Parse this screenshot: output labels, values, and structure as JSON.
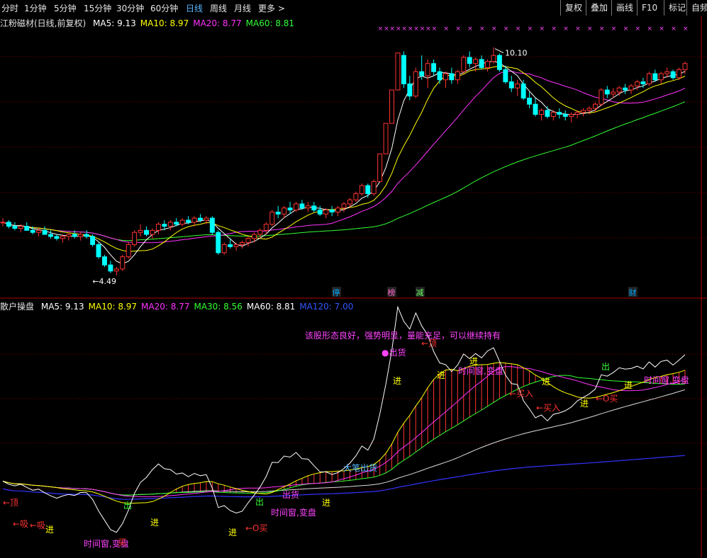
{
  "toolbar": {
    "periods": [
      "分时",
      "1分钟",
      "5分钟",
      "15分钟",
      "30分钟",
      "60分钟",
      "日线",
      "周线",
      "月线",
      "更多 >"
    ],
    "active_period": "日线",
    "right_buttons": [
      "复权",
      "叠加",
      "画线",
      "F10",
      "标记",
      "自频"
    ]
  },
  "price_panel": {
    "title": "江粉磁材(日线,前复权)",
    "ma": [
      {
        "label": "MA5: 9.13",
        "color": "#ffffff"
      },
      {
        "label": "MA10: 8.97",
        "color": "#ffff00"
      },
      {
        "label": "MA20: 8.77",
        "color": "#ff33ff"
      },
      {
        "label": "MA60: 8.81",
        "color": "#33ff33"
      }
    ],
    "high_label": "10.10",
    "low_label": "4.49",
    "badges": [
      {
        "text": "停",
        "color": "#00aaff"
      },
      {
        "text": "榜",
        "color": "#ff66cc"
      },
      {
        "text": "减",
        "color": "#66ff66"
      },
      {
        "text": "财",
        "color": "#00aaff"
      }
    ],
    "x_marker": "×"
  },
  "indicator_panel": {
    "title": "散户操盘",
    "ma": [
      {
        "label": "MA5: 9.13",
        "color": "#ffffff"
      },
      {
        "label": "MA10: 8.97",
        "color": "#ffff00"
      },
      {
        "label": "MA20: 8.77",
        "color": "#ff33ff"
      },
      {
        "label": "MA30: 8.56",
        "color": "#33ff33"
      },
      {
        "label": "MA60: 8.81",
        "color": "#ffffff"
      },
      {
        "label": "MA120: 7.00",
        "color": "#3355ff"
      }
    ],
    "comment": "该股形态良好，强势明显，量能充足，可以继续持有",
    "annotations": [
      {
        "text": "←顶",
        "color": "#ff3333"
      },
      {
        "text": "←吸",
        "color": "#ff3333"
      },
      {
        "text": "←吸",
        "color": "#ff3333"
      },
      {
        "text": "进",
        "color": "#ffff00"
      },
      {
        "text": "出",
        "color": "#33ff33"
      },
      {
        "text": "时间窗,变盘",
        "color": "#ff44ff"
      },
      {
        "text": "买",
        "color": "#ff3333"
      },
      {
        "text": "进",
        "color": "#ffff00"
      },
      {
        "text": "进",
        "color": "#ffff00"
      },
      {
        "text": "←O买",
        "color": "#ff3333"
      },
      {
        "text": "出",
        "color": "#33ff33"
      },
      {
        "text": "出货",
        "color": "#ff44ff"
      },
      {
        "text": "时间窗,变盘",
        "color": "#ff44ff"
      },
      {
        "text": "进",
        "color": "#ffff00"
      },
      {
        "text": "大笔出货",
        "color": "#55bbff"
      },
      {
        "text": "●出货",
        "color": "#ff44ff"
      },
      {
        "text": "进",
        "color": "#ffff00"
      },
      {
        "text": "←顶",
        "color": "#ff3333"
      },
      {
        "text": "进",
        "color": "#ffff00"
      },
      {
        "text": "进",
        "color": "#ffff00"
      },
      {
        "text": "时间窗,变盘",
        "color": "#ff44ff"
      },
      {
        "text": "←买入",
        "color": "#ff3333"
      },
      {
        "text": "进",
        "color": "#ffff00"
      },
      {
        "text": "←买入",
        "color": "#ff3333"
      },
      {
        "text": "进",
        "color": "#ffff00"
      },
      {
        "text": "←O买",
        "color": "#ff3333"
      },
      {
        "text": "出",
        "color": "#33ff33"
      },
      {
        "text": "进",
        "color": "#ffff00"
      },
      {
        "text": "时间窗,变盘",
        "color": "#ff44ff"
      }
    ]
  },
  "chart_data": {
    "type": "candlestick",
    "up_color": "#ff3333",
    "down_color": "#00ffff",
    "ohlc": [
      [
        5.8,
        5.9,
        5.7,
        5.8
      ],
      [
        5.8,
        5.85,
        5.65,
        5.7
      ],
      [
        5.7,
        5.8,
        5.6,
        5.65
      ],
      [
        5.65,
        5.75,
        5.55,
        5.7
      ],
      [
        5.7,
        5.8,
        5.6,
        5.6
      ],
      [
        5.6,
        5.7,
        5.5,
        5.55
      ],
      [
        5.55,
        5.65,
        5.45,
        5.6
      ],
      [
        5.6,
        5.7,
        5.5,
        5.5
      ],
      [
        5.5,
        5.6,
        5.4,
        5.45
      ],
      [
        5.45,
        5.5,
        5.35,
        5.4
      ],
      [
        5.4,
        5.5,
        5.3,
        5.45
      ],
      [
        5.45,
        5.55,
        5.35,
        5.5
      ],
      [
        5.5,
        5.6,
        5.4,
        5.45
      ],
      [
        5.45,
        5.55,
        5.35,
        5.5
      ],
      [
        5.5,
        5.6,
        5.4,
        5.45
      ],
      [
        5.45,
        5.5,
        5.2,
        5.25
      ],
      [
        5.25,
        5.3,
        4.9,
        4.95
      ],
      [
        4.95,
        5.0,
        4.7,
        4.75
      ],
      [
        4.75,
        4.85,
        4.55,
        4.6
      ],
      [
        4.6,
        4.7,
        4.49,
        4.65
      ],
      [
        4.65,
        5.0,
        4.6,
        4.95
      ],
      [
        4.95,
        5.3,
        4.9,
        5.25
      ],
      [
        5.25,
        5.6,
        5.2,
        5.55
      ],
      [
        5.55,
        5.75,
        5.45,
        5.6
      ],
      [
        5.6,
        5.7,
        5.45,
        5.5
      ],
      [
        5.5,
        5.65,
        5.4,
        5.6
      ],
      [
        5.6,
        5.8,
        5.5,
        5.75
      ],
      [
        5.75,
        5.85,
        5.6,
        5.7
      ],
      [
        5.7,
        5.85,
        5.6,
        5.8
      ],
      [
        5.8,
        5.9,
        5.7,
        5.75
      ],
      [
        5.75,
        5.9,
        5.7,
        5.85
      ],
      [
        5.85,
        5.95,
        5.75,
        5.8
      ],
      [
        5.8,
        5.95,
        5.7,
        5.9
      ],
      [
        5.9,
        6.0,
        5.8,
        5.85
      ],
      [
        5.85,
        5.95,
        5.75,
        5.9
      ],
      [
        5.9,
        5.95,
        5.5,
        5.55
      ],
      [
        5.55,
        5.6,
        5.0,
        5.05
      ],
      [
        5.05,
        5.3,
        5.0,
        5.25
      ],
      [
        5.25,
        5.4,
        5.15,
        5.2
      ],
      [
        5.2,
        5.3,
        5.1,
        5.25
      ],
      [
        5.25,
        5.35,
        5.15,
        5.3
      ],
      [
        5.3,
        5.45,
        5.2,
        5.4
      ],
      [
        5.4,
        5.55,
        5.3,
        5.5
      ],
      [
        5.5,
        5.65,
        5.4,
        5.6
      ],
      [
        5.6,
        5.8,
        5.5,
        5.75
      ],
      [
        5.75,
        6.1,
        5.7,
        6.05
      ],
      [
        6.05,
        6.2,
        5.9,
        6.0
      ],
      [
        6.0,
        6.2,
        5.9,
        6.15
      ],
      [
        6.15,
        6.3,
        6.0,
        6.1
      ],
      [
        6.1,
        6.3,
        6.05,
        6.25
      ],
      [
        6.25,
        6.35,
        6.1,
        6.15
      ],
      [
        6.15,
        6.3,
        6.05,
        6.2
      ],
      [
        6.2,
        6.3,
        6.05,
        6.1
      ],
      [
        6.1,
        6.2,
        5.95,
        6.0
      ],
      [
        6.0,
        6.15,
        5.9,
        6.1
      ],
      [
        6.1,
        6.2,
        5.95,
        6.05
      ],
      [
        6.05,
        6.2,
        5.95,
        6.15
      ],
      [
        6.15,
        6.3,
        6.05,
        6.25
      ],
      [
        6.25,
        6.4,
        6.15,
        6.35
      ],
      [
        6.35,
        6.55,
        6.3,
        6.5
      ],
      [
        6.5,
        6.75,
        6.45,
        6.7
      ],
      [
        6.7,
        6.75,
        6.4,
        6.5
      ],
      [
        6.5,
        6.85,
        6.45,
        6.8
      ],
      [
        6.8,
        7.48,
        6.8,
        7.48
      ],
      [
        7.48,
        8.23,
        7.48,
        8.23
      ],
      [
        8.23,
        9.05,
        8.23,
        9.05
      ],
      [
        9.05,
        9.96,
        9.05,
        9.96
      ],
      [
        9.9,
        10.0,
        9.1,
        9.2
      ],
      [
        9.2,
        9.4,
        8.8,
        8.9
      ],
      [
        8.9,
        9.6,
        8.85,
        9.5
      ],
      [
        9.5,
        9.9,
        9.3,
        9.4
      ],
      [
        9.4,
        9.8,
        9.1,
        9.7
      ],
      [
        9.7,
        9.8,
        9.4,
        9.5
      ],
      [
        9.5,
        9.6,
        9.2,
        9.3
      ],
      [
        9.3,
        9.5,
        9.1,
        9.45
      ],
      [
        9.45,
        9.6,
        9.2,
        9.3
      ],
      [
        9.3,
        9.55,
        9.2,
        9.5
      ],
      [
        9.5,
        9.9,
        9.45,
        9.85
      ],
      [
        9.85,
        10.0,
        9.6,
        9.7
      ],
      [
        9.7,
        9.85,
        9.5,
        9.8
      ],
      [
        9.8,
        9.9,
        9.55,
        9.6
      ],
      [
        9.6,
        9.8,
        9.5,
        9.75
      ],
      [
        9.75,
        10.1,
        9.7,
        9.9
      ],
      [
        9.9,
        9.95,
        9.5,
        9.55
      ],
      [
        9.55,
        9.65,
        9.2,
        9.25
      ],
      [
        9.25,
        9.4,
        9.0,
        9.1
      ],
      [
        9.1,
        9.3,
        8.9,
        9.2
      ],
      [
        9.2,
        9.3,
        8.8,
        8.85
      ],
      [
        8.85,
        9.0,
        8.6,
        8.7
      ],
      [
        8.7,
        8.85,
        8.4,
        8.45
      ],
      [
        8.45,
        8.6,
        8.3,
        8.55
      ],
      [
        8.55,
        8.65,
        8.35,
        8.4
      ],
      [
        8.4,
        8.55,
        8.3,
        8.5
      ],
      [
        8.5,
        8.6,
        8.35,
        8.45
      ],
      [
        8.45,
        8.55,
        8.3,
        8.4
      ],
      [
        8.4,
        8.5,
        8.25,
        8.45
      ],
      [
        8.45,
        8.55,
        8.35,
        8.5
      ],
      [
        8.5,
        8.6,
        8.4,
        8.55
      ],
      [
        8.55,
        8.65,
        8.45,
        8.6
      ],
      [
        8.6,
        8.75,
        8.5,
        8.7
      ],
      [
        8.7,
        9.1,
        8.65,
        9.05
      ],
      [
        9.05,
        9.15,
        8.85,
        8.95
      ],
      [
        8.95,
        9.1,
        8.85,
        9.0
      ],
      [
        9.0,
        9.15,
        8.9,
        9.1
      ],
      [
        9.1,
        9.2,
        8.95,
        9.05
      ],
      [
        9.05,
        9.2,
        8.95,
        9.15
      ],
      [
        9.15,
        9.3,
        9.05,
        9.25
      ],
      [
        9.25,
        9.35,
        9.1,
        9.2
      ],
      [
        9.2,
        9.5,
        9.15,
        9.45
      ],
      [
        9.45,
        9.55,
        9.25,
        9.3
      ],
      [
        9.3,
        9.5,
        9.2,
        9.45
      ],
      [
        9.45,
        9.6,
        9.35,
        9.5
      ],
      [
        9.5,
        9.55,
        9.3,
        9.35
      ],
      [
        9.35,
        9.6,
        9.3,
        9.55
      ],
      [
        9.55,
        9.75,
        9.45,
        9.7
      ]
    ],
    "ylim": [
      4.3,
      10.6
    ],
    "indicator_ylim": [
      4.3,
      10.6
    ]
  }
}
